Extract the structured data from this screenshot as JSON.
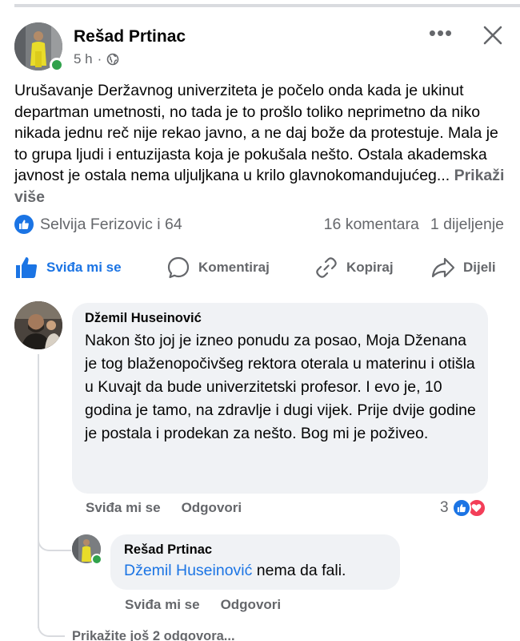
{
  "post": {
    "author": "Rešad Prtinac",
    "time": "5 h",
    "separator": "·",
    "text": "Urušavanje Deržavnog univerziteta je počelo onda kada je ukinut departman umetnosti, no tada je to prošlo toliko neprimetno da niko nikada jednu reč nije rekao javno, a ne daj bože da protestuje. Mala je to grupa ljudi i entuzijasta koja je pokušala nešto. Ostala akademska javnost je ostala nema uljuljkana u krilo glavnokomandujućeg...",
    "see_more": "Prikaži više",
    "more_icon": "•••"
  },
  "stats": {
    "reactions": "Selvija Ferizovic i 64",
    "comments": "16 komentara",
    "shares": "1 dijeljenje"
  },
  "actions": {
    "like": "Sviđa mi se",
    "comment": "Komentiraj",
    "copy": "Kopiraj",
    "share": "Dijeli"
  },
  "comments": [
    {
      "author": "Džemil Huseinović",
      "text": "Nakon što joj je izneo ponudu za posao, Moja Dženana je tog blaženopočivšeg rektora oterala u materinu i otišla u Kuvajt da bude univerzitetski profesor. I evo je, 10 godina je tamo, na zdravlje i dugi vijek. Prije dvije godine je postala i prodekan za nešto. Bog mi je poživeo.",
      "like": "Sviđa mi se",
      "reply": "Odgovori",
      "reaction_count": "3"
    },
    {
      "author": "Rešad Prtinac",
      "mention": "Džemil Huseinović",
      "text": " nema da fali.",
      "like": "Sviđa mi se",
      "reply": "Odgovori"
    }
  ],
  "more_replies": "Prikažite još 2 odgovora...",
  "colors": {
    "accent": "#1b74e4",
    "online": "#31a24c",
    "love": "#f33e58",
    "muted": "#65676b",
    "bubble": "#f0f2f5"
  },
  "icons": [
    "globe-icon",
    "more-icon",
    "close-icon",
    "like-icon",
    "comment-icon",
    "link-icon",
    "share-icon",
    "love-icon"
  ]
}
